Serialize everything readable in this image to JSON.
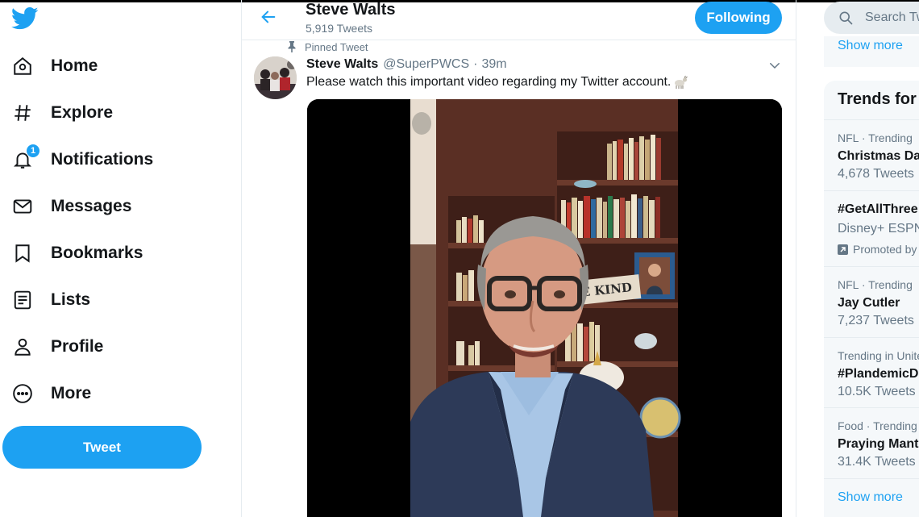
{
  "nav": {
    "items": [
      {
        "label": "Home",
        "icon": "home-icon"
      },
      {
        "label": "Explore",
        "icon": "hashtag-icon"
      },
      {
        "label": "Notifications",
        "icon": "bell-icon",
        "badge": "1"
      },
      {
        "label": "Messages",
        "icon": "envelope-icon"
      },
      {
        "label": "Bookmarks",
        "icon": "bookmark-icon"
      },
      {
        "label": "Lists",
        "icon": "list-icon"
      },
      {
        "label": "Profile",
        "icon": "person-icon"
      },
      {
        "label": "More",
        "icon": "more-circle-icon"
      }
    ],
    "tweet_label": "Tweet"
  },
  "profile_header": {
    "name": "Steve Walts",
    "tweet_count": "5,919 Tweets",
    "follow_label": "Following"
  },
  "tweet": {
    "pinned_label": "Pinned Tweet",
    "author_name": "Steve Walts",
    "handle": "@SuperPWCS",
    "separator": "·",
    "time": "39m",
    "text": "Please watch this important video regarding my Twitter account.",
    "video_overlay_text": "BE KIND"
  },
  "sidebar": {
    "search_placeholder": "Search Tw",
    "show_more_top": "Show more",
    "trends_title": "Trends for",
    "trends": [
      {
        "context": "NFL · Trending",
        "name": "Christmas Day",
        "count": "4,678 Tweets"
      },
      {
        "context": "",
        "name": "#GetAllThree",
        "count": "Disney+ ESPN",
        "promoted": "Promoted by"
      },
      {
        "context": "NFL · Trending",
        "name": "Jay Cutler",
        "count": "7,237 Tweets"
      },
      {
        "context": "Trending in Unite",
        "name": "#PlandemicDo",
        "count": "10.5K Tweets"
      },
      {
        "context": "Food · Trending",
        "name": "Praying Mant",
        "count": "31.4K Tweets"
      }
    ],
    "show_more_bottom": "Show more"
  },
  "colors": {
    "accent": "#1da1f2",
    "text_primary": "#14171a",
    "text_secondary": "#657786",
    "panel_bg": "#f5f8fa"
  }
}
